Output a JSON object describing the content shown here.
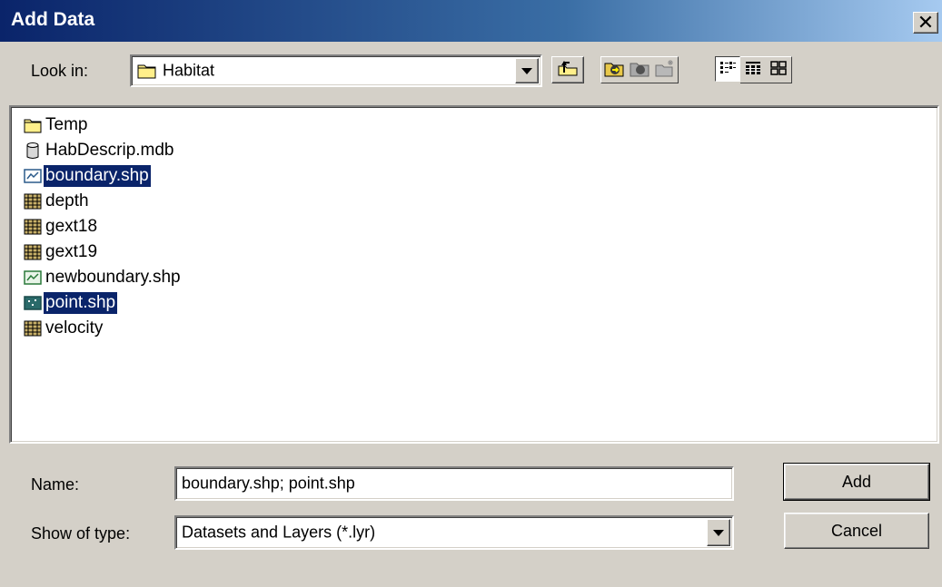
{
  "window": {
    "title": "Add Data",
    "close_glyph": "✕"
  },
  "look_in": {
    "label": "Look in:",
    "value": "Habitat",
    "icon": "folder-icon"
  },
  "toolbar": {
    "buttons": [
      {
        "name": "up-one-level",
        "icon": "up-folder-icon"
      },
      {
        "name": "connect-to-folder",
        "icon": "connect-folder-icon"
      },
      {
        "name": "disconnect-folder",
        "icon": "disconnect-folder-icon"
      },
      {
        "name": "new-folder",
        "icon": "new-folder-icon"
      },
      {
        "name": "list-view",
        "icon": "list-view-icon"
      },
      {
        "name": "details-view",
        "icon": "details-view-icon"
      },
      {
        "name": "thumbnails-view",
        "icon": "thumbnails-view-icon"
      }
    ]
  },
  "files": [
    {
      "label": "Temp",
      "icon": "folder-icon",
      "selected": false
    },
    {
      "label": "HabDescrip.mdb",
      "icon": "database-icon",
      "selected": false
    },
    {
      "label": "boundary.shp",
      "icon": "line-shapefile-icon",
      "selected": true
    },
    {
      "label": "depth",
      "icon": "raster-icon",
      "selected": false
    },
    {
      "label": "gext18",
      "icon": "raster-icon",
      "selected": false
    },
    {
      "label": "gext19",
      "icon": "raster-icon",
      "selected": false
    },
    {
      "label": "newboundary.shp",
      "icon": "line-shapefile-icon",
      "selected": false
    },
    {
      "label": "point.shp",
      "icon": "point-shapefile-icon",
      "selected": true
    },
    {
      "label": "velocity",
      "icon": "raster-icon",
      "selected": false
    }
  ],
  "name_field": {
    "label": "Name:",
    "value": "boundary.shp; point.shp"
  },
  "type_field": {
    "label": "Show of type:",
    "value": "Datasets and Layers (*.lyr)"
  },
  "buttons": {
    "add": "Add",
    "cancel": "Cancel"
  },
  "colors": {
    "selection": "#0a246a",
    "face": "#d4d0c8"
  }
}
